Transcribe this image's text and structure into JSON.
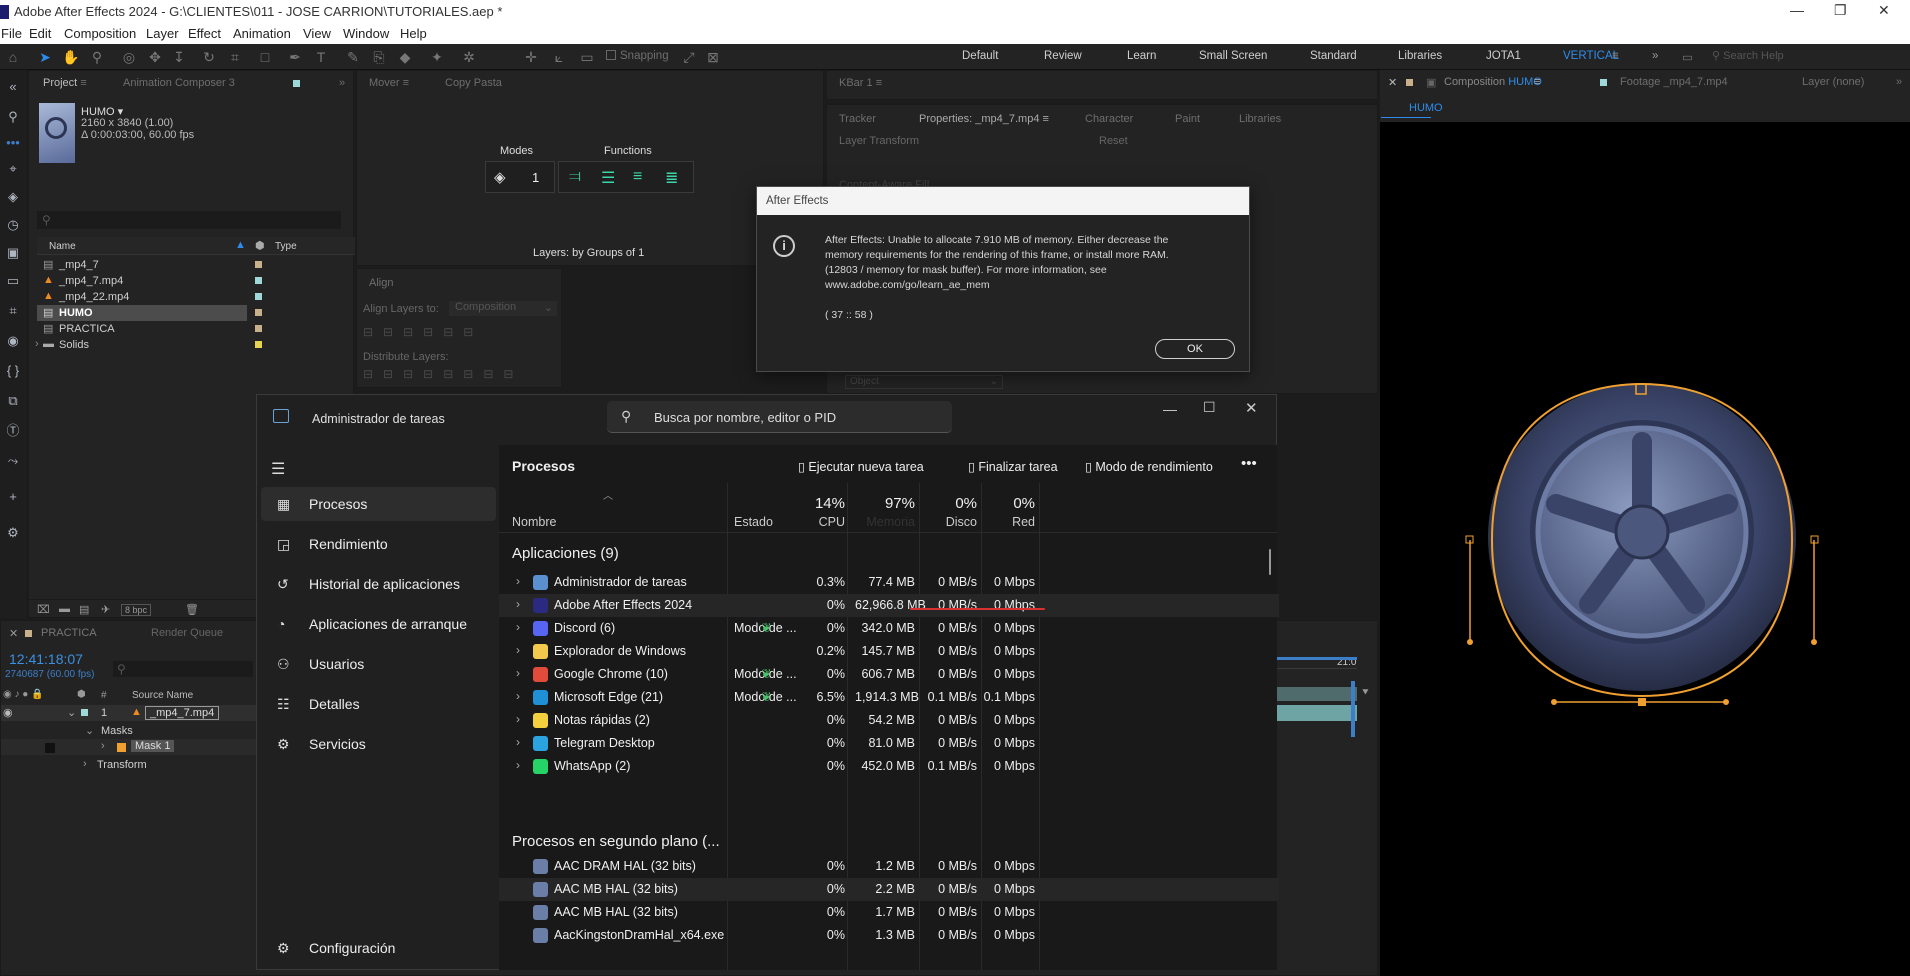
{
  "window": {
    "title": "Adobe After Effects 2024 - G:\\CLIENTES\\011 - JOSE CARRION\\TUTORIALES.aep *"
  },
  "menu": [
    "File",
    "Edit",
    "Composition",
    "Layer",
    "Effect",
    "Animation",
    "View",
    "Window",
    "Help"
  ],
  "toolbar": {
    "snapping": "Snapping",
    "search_placeholder": "Search Help",
    "workspaces": [
      "Default",
      "Review",
      "Learn",
      "Small Screen",
      "Standard",
      "Libraries",
      "JOTA1",
      "VERTICAL"
    ],
    "active_workspace": "VERTICAL"
  },
  "project": {
    "tabs": [
      "Project",
      "Animation Composer 3"
    ],
    "preview": {
      "name": "HUMO",
      "size": "2160 x 3840 (1.00)",
      "duration": "Δ 0:00:03:00, 60.00 fps"
    },
    "columns": {
      "name": "Name",
      "type": "Type"
    },
    "items": [
      {
        "name": "_mp4_7",
        "color": "#c8b08a",
        "kind": "comp"
      },
      {
        "name": "_mp4_7.mp4",
        "color": "#9ed8d8",
        "kind": "video"
      },
      {
        "name": "_mp4_22.mp4",
        "color": "#9ed8d8",
        "kind": "video"
      },
      {
        "name": "HUMO",
        "color": "#c8b08a",
        "kind": "comp",
        "selected": true
      },
      {
        "name": "PRACTICA",
        "color": "#c8b08a",
        "kind": "comp"
      },
      {
        "name": "Solids",
        "color": "#e6d450",
        "kind": "folder"
      }
    ],
    "bpc": "8 bpc"
  },
  "mover": {
    "tabs": [
      "Mover",
      "Copy Pasta"
    ],
    "modes_label": "Modes",
    "functions_label": "Functions",
    "modes_value": "1",
    "layers_label": "Layers: by Groups of 1"
  },
  "align": {
    "title": "Align",
    "align_to_label": "Align Layers to:",
    "align_to_value": "Composition",
    "distribute": "Distribute Layers:"
  },
  "kbar": {
    "title": "KBar 1"
  },
  "properties": {
    "tabs": [
      "Tracker",
      "Properties: _mp4_7.mp4",
      "Character",
      "Paint",
      "Libraries"
    ],
    "layer_transform": "Layer Transform",
    "reset": "Reset",
    "content_aware": "Content-Aware Fill",
    "object": "Object"
  },
  "comp": {
    "tabs": [
      "Composition HUMO",
      "Footage _mp4_7.mp4",
      "Layer (none)"
    ],
    "breadcrumb": "HUMO"
  },
  "timeline": {
    "tabs": [
      "PRACTICA",
      "Render Queue"
    ],
    "timecode": "12:41:18:07",
    "frame": "2740687 (60.00 fps)",
    "source_col": "Source Name",
    "layer_num": "1",
    "layer_name": "_mp4_7.mp4",
    "masks": "Masks",
    "mask1": "Mask 1",
    "transform": "Transform",
    "ruler_end": "21:0"
  },
  "ae_dialog": {
    "title": "After Effects",
    "message": [
      "After Effects: Unable to allocate 7.910 MB of memory. Either decrease the",
      "memory requirements for the rendering of this frame, or install more RAM.",
      "(12803 / memory for mask buffer). For more information, see",
      "www.adobe.com/go/learn_ae_mem"
    ],
    "code": "( 37 :: 58 )",
    "ok": "OK"
  },
  "taskmgr": {
    "title": "Administrador de tareas",
    "search_placeholder": "Busca por nombre, editor o PID",
    "nav": [
      {
        "label": "Procesos",
        "icon": "processes-icon",
        "active": true
      },
      {
        "label": "Rendimiento",
        "icon": "performance-icon"
      },
      {
        "label": "Historial de aplicaciones",
        "icon": "history-icon"
      },
      {
        "label": "Aplicaciones de arranque",
        "icon": "startup-icon"
      },
      {
        "label": "Usuarios",
        "icon": "users-icon"
      },
      {
        "label": "Detalles",
        "icon": "details-icon"
      },
      {
        "label": "Servicios",
        "icon": "services-icon"
      }
    ],
    "settings": "Configuración",
    "heading": "Procesos",
    "actions": {
      "new_task": "Ejecutar nueva tarea",
      "end_task": "Finalizar tarea",
      "efficiency": "Modo de rendimiento"
    },
    "columns": {
      "name": "Nombre",
      "status": "Estado",
      "cpu": "CPU",
      "mem": "Memoria",
      "disk": "Disco",
      "net": "Red"
    },
    "totals": {
      "cpu": "14%",
      "mem": "97%",
      "disk": "0%",
      "net": "0%"
    },
    "apps_group": "Aplicaciones (9)",
    "bg_group": "Procesos en segundo plano (...",
    "apps": [
      {
        "name": "Administrador de tareas",
        "status": "",
        "cpu": "0.3%",
        "mem": "77.4 MB",
        "disk": "0 MB/s",
        "net": "0 Mbps",
        "color": "#5a8fd0"
      },
      {
        "name": "Adobe After Effects 2024",
        "status": "",
        "cpu": "0%",
        "mem": "62,966.8 MB",
        "disk": "0 MB/s",
        "net": "0 Mbps",
        "color": "#2a2a80"
      },
      {
        "name": "Discord (6)",
        "status": "Modo de ...",
        "cpu": "0%",
        "mem": "342.0 MB",
        "disk": "0 MB/s",
        "net": "0 Mbps",
        "color": "#5865f2"
      },
      {
        "name": "Explorador de Windows",
        "status": "",
        "cpu": "0.2%",
        "mem": "145.7 MB",
        "disk": "0 MB/s",
        "net": "0 Mbps",
        "color": "#f2c94c"
      },
      {
        "name": "Google Chrome (10)",
        "status": "Modo de ...",
        "cpu": "0%",
        "mem": "606.7 MB",
        "disk": "0 MB/s",
        "net": "0 Mbps",
        "color": "#e14b3b"
      },
      {
        "name": "Microsoft Edge (21)",
        "status": "Modo de ...",
        "cpu": "6.5%",
        "mem": "1,914.3 MB",
        "disk": "0.1 MB/s",
        "net": "0.1 Mbps",
        "color": "#1f8fd6"
      },
      {
        "name": "Notas rápidas (2)",
        "status": "",
        "cpu": "0%",
        "mem": "54.2 MB",
        "disk": "0 MB/s",
        "net": "0 Mbps",
        "color": "#f4d03f"
      },
      {
        "name": "Telegram Desktop",
        "status": "",
        "cpu": "0%",
        "mem": "81.0 MB",
        "disk": "0 MB/s",
        "net": "0 Mbps",
        "color": "#2aa3df"
      },
      {
        "name": "WhatsApp (2)",
        "status": "",
        "cpu": "0%",
        "mem": "452.0 MB",
        "disk": "0.1 MB/s",
        "net": "0 Mbps",
        "color": "#25d366"
      }
    ],
    "bg": [
      {
        "name": "AAC DRAM HAL (32 bits)",
        "cpu": "0%",
        "mem": "1.2 MB",
        "disk": "0 MB/s",
        "net": "0 Mbps"
      },
      {
        "name": "AAC MB HAL (32 bits)",
        "cpu": "0%",
        "mem": "2.2 MB",
        "disk": "0 MB/s",
        "net": "0 Mbps"
      },
      {
        "name": "AAC MB HAL (32 bits)",
        "cpu": "0%",
        "mem": "1.7 MB",
        "disk": "0 MB/s",
        "net": "0 Mbps"
      },
      {
        "name": "AacKingstonDramHal_x64.exe",
        "cpu": "0%",
        "mem": "1.3 MB",
        "disk": "0 MB/s",
        "net": "0 Mbps"
      }
    ]
  },
  "colors": {
    "accent_blue": "#2d8ceb",
    "mask_orange": "#f0a030",
    "highlight_red": "#d93030"
  }
}
